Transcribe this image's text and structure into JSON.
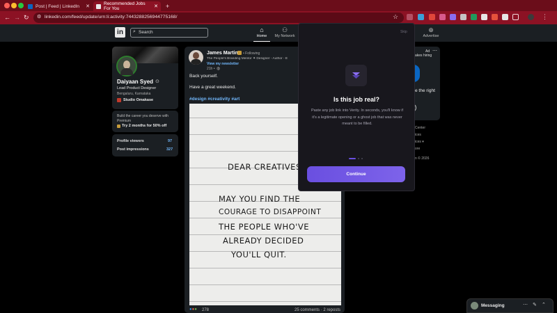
{
  "browser": {
    "tabs": [
      {
        "label": "Post | Feed | LinkedIn",
        "active": false
      },
      {
        "label": "Recommended Jobs For You",
        "active": true
      }
    ],
    "new_tab": "+",
    "url": "linkedin.com/feed/update/urn:li:activity:7443288256944775168/",
    "colors": {
      "frame": "#6b0d1a",
      "toolbar": "#8c1224"
    }
  },
  "linkedin_header": {
    "logo": "in",
    "search_placeholder": "Search",
    "nav": [
      {
        "label": "Home",
        "icon": "home-icon",
        "active": true
      },
      {
        "label": "My Network",
        "icon": "network-icon"
      },
      {
        "label": "Advertise",
        "icon": "advertise-icon"
      }
    ]
  },
  "profile": {
    "name": "Daiyaan Syed",
    "headline": "Lead Product Designer",
    "location": "Bengaluru, Karnataka",
    "company": "Studio Omakase",
    "premium_text": "Build the career you deserve with Premium",
    "premium_cta": "Try 2 months for 50% off",
    "stats": [
      {
        "label": "Profile viewers",
        "value": "97"
      },
      {
        "label": "Post impressions",
        "value": "327"
      }
    ]
  },
  "post": {
    "author": "James Martin",
    "following": "• Following",
    "author_subtitle": "The People's Branding Mentor ✦ Designer - Author - E",
    "newsletter": "View my newsletter",
    "time": "21h •",
    "lines": [
      "Back yourself.",
      "Have a great weekend."
    ],
    "hashtags": "#design #creativity #art",
    "image_text": [
      "DEAR CREATIVES",
      "MAY YOU FIND THE",
      "COURAGE TO DISAPPOINT",
      "THE PEOPLE WHO'VE",
      "ALREADY DECIDED",
      "YOU'LL QUIT."
    ],
    "reactions": "278",
    "comments_reposts": "25 comments · 2 reposts"
  },
  "right_rail": {
    "ad_label": "Ad",
    "ad_line": "akes hiring",
    "ad_line2": "e the right",
    "links": [
      "Center",
      "ices",
      "ices ▾",
      "ore"
    ],
    "copyright": "n © 2026"
  },
  "popup": {
    "skip": "Skip",
    "title": "Is this job real?",
    "body": "Paste any job link into Verity. In seconds, you'll know if it's a legitimate opening or a ghost job that was never meant to be filled.",
    "button": "Continue",
    "steps": 3,
    "active_step": 1,
    "accent": "#6a4fe0"
  },
  "messaging": {
    "label": "Messaging"
  }
}
